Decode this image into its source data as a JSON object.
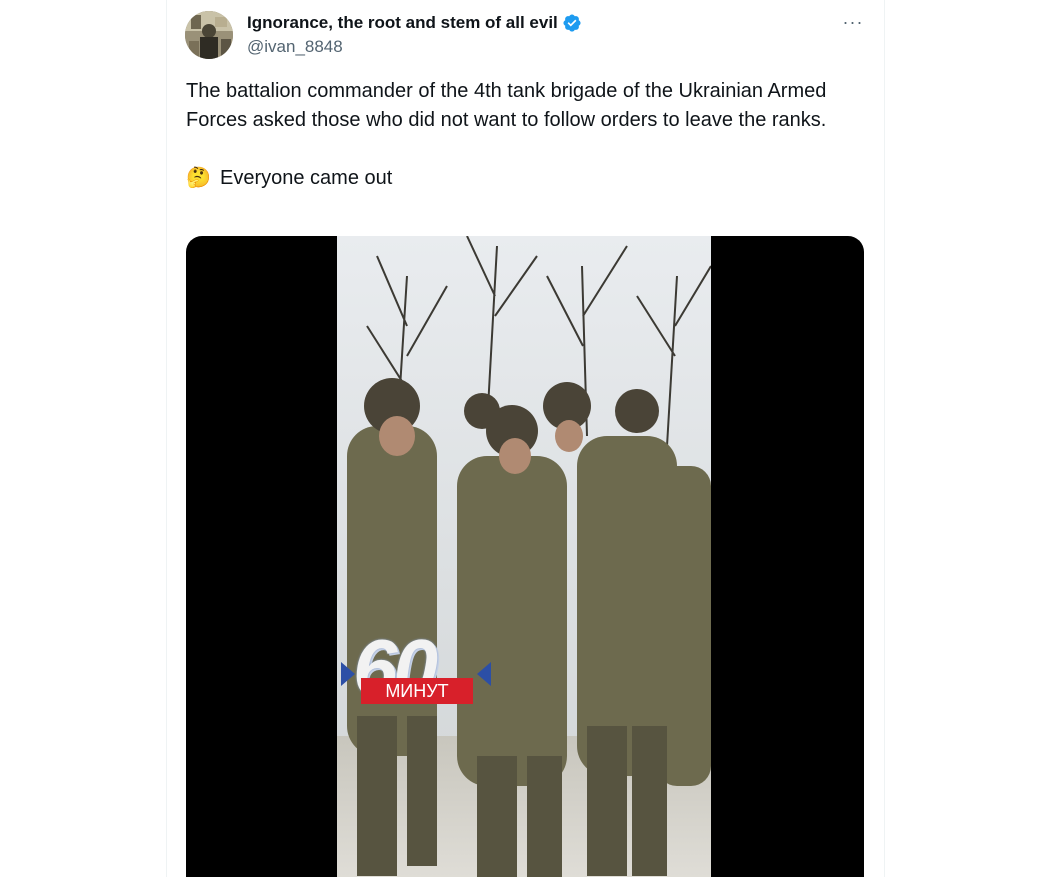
{
  "author": {
    "display_name": "Ignorance, the root and stem of all evil",
    "handle": "@ivan_8848",
    "verified": true,
    "verified_color": "#1d9bf0"
  },
  "menu": {
    "more_icon": "more-horizontal-icon",
    "more_label": "···"
  },
  "tweet": {
    "text_line_1": "The battalion commander of the 4th tank brigade of the Ukrainian Armed Forces asked those who did not want to follow orders to leave the ranks.",
    "emoji": "🤔",
    "text_line_2": "Everyone came out"
  },
  "media": {
    "overlay_number": "60",
    "overlay_label": "МИНУТ"
  },
  "colors": {
    "text_primary": "#0f1419",
    "text_secondary": "#536471",
    "border": "#eff3f4",
    "logo_red": "#d8202a",
    "logo_blue": "#2c4fa6"
  }
}
